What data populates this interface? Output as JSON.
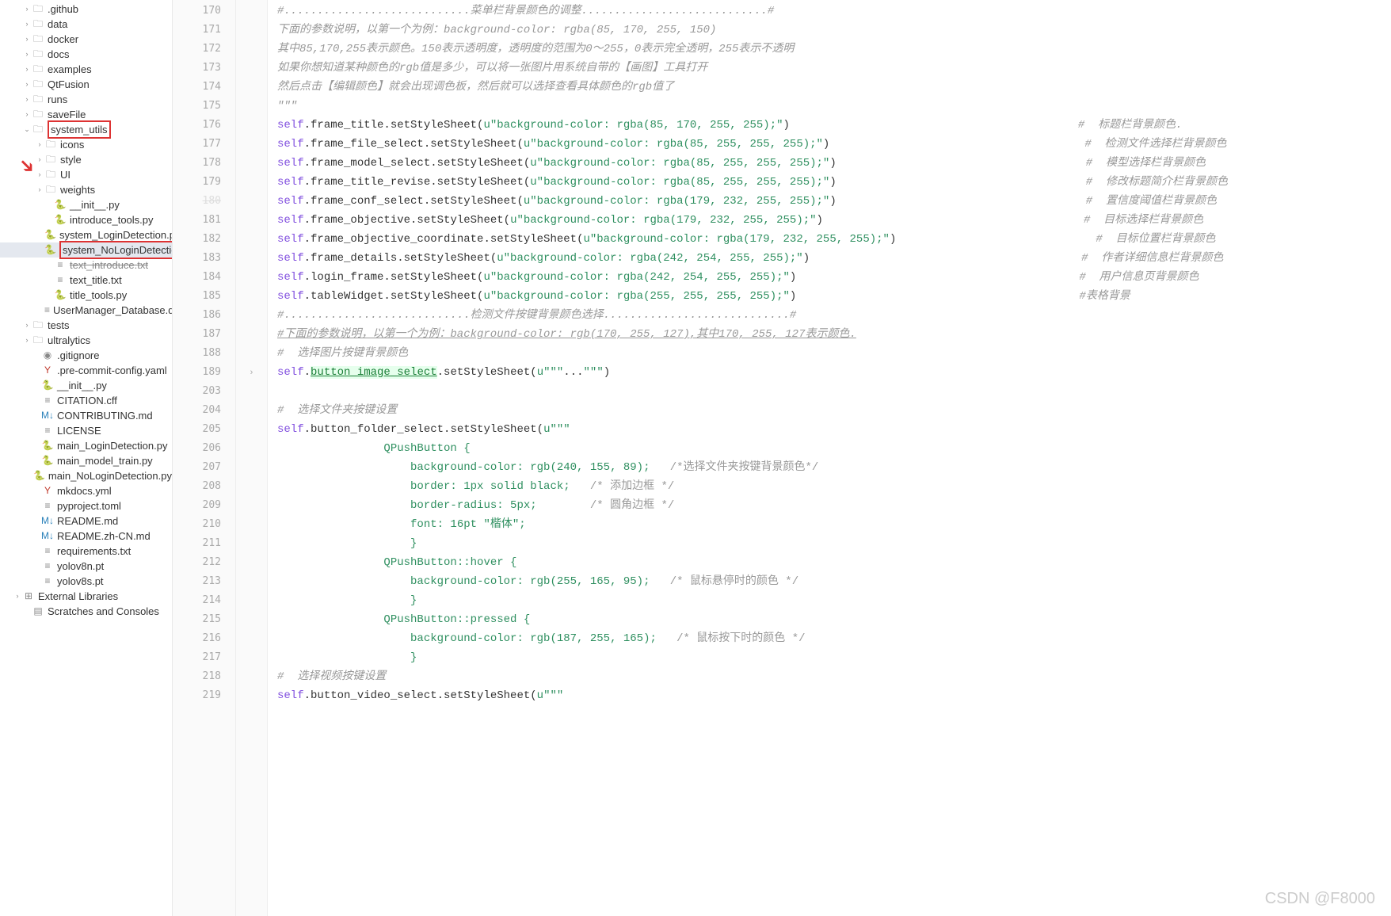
{
  "tree": [
    {
      "indent": 28,
      "arrow": "›",
      "icon": "folder",
      "label": ".github"
    },
    {
      "indent": 28,
      "arrow": "›",
      "icon": "folder",
      "label": "data"
    },
    {
      "indent": 28,
      "arrow": "›",
      "icon": "folder",
      "label": "docker"
    },
    {
      "indent": 28,
      "arrow": "›",
      "icon": "folder",
      "label": "docs"
    },
    {
      "indent": 28,
      "arrow": "›",
      "icon": "folder",
      "label": "examples"
    },
    {
      "indent": 28,
      "arrow": "›",
      "icon": "folder",
      "label": "QtFusion"
    },
    {
      "indent": 28,
      "arrow": "›",
      "icon": "folder",
      "label": "runs"
    },
    {
      "indent": 28,
      "arrow": "›",
      "icon": "folder",
      "label": "saveFile"
    },
    {
      "indent": 28,
      "arrow": "⌄",
      "icon": "folder",
      "label": "system_utils",
      "boxed": true
    },
    {
      "indent": 44,
      "arrow": "›",
      "icon": "folder",
      "label": "icons"
    },
    {
      "indent": 44,
      "arrow": "›",
      "icon": "folder",
      "label": "style"
    },
    {
      "indent": 44,
      "arrow": "›",
      "icon": "folder",
      "label": "UI"
    },
    {
      "indent": 44,
      "arrow": "›",
      "icon": "folder",
      "label": "weights"
    },
    {
      "indent": 56,
      "arrow": "",
      "icon": "py",
      "label": "__init__.py"
    },
    {
      "indent": 56,
      "arrow": "",
      "icon": "py",
      "label": "introduce_tools.py"
    },
    {
      "indent": 56,
      "arrow": "",
      "icon": "py",
      "label": "system_LoginDetection.py"
    },
    {
      "indent": 56,
      "arrow": "",
      "icon": "py",
      "label": "system_NoLoginDetection.py",
      "boxed": true,
      "selected": true
    },
    {
      "indent": 56,
      "arrow": "",
      "icon": "txt",
      "label": "text_introduce.txt",
      "strike": true
    },
    {
      "indent": 56,
      "arrow": "",
      "icon": "txt",
      "label": "text_title.txt"
    },
    {
      "indent": 56,
      "arrow": "",
      "icon": "py",
      "label": "title_tools.py"
    },
    {
      "indent": 56,
      "arrow": "",
      "icon": "db",
      "label": "UserManager_Database.db"
    },
    {
      "indent": 28,
      "arrow": "›",
      "icon": "folder",
      "label": "tests"
    },
    {
      "indent": 28,
      "arrow": "›",
      "icon": "folder",
      "label": "ultralytics"
    },
    {
      "indent": 40,
      "arrow": "",
      "icon": "git",
      "label": ".gitignore"
    },
    {
      "indent": 40,
      "arrow": "",
      "icon": "yaml",
      "label": ".pre-commit-config.yaml"
    },
    {
      "indent": 40,
      "arrow": "",
      "icon": "py",
      "label": "__init__.py"
    },
    {
      "indent": 40,
      "arrow": "",
      "icon": "txt",
      "label": "CITATION.cff"
    },
    {
      "indent": 40,
      "arrow": "",
      "icon": "md",
      "label": "CONTRIBUTING.md"
    },
    {
      "indent": 40,
      "arrow": "",
      "icon": "txt",
      "label": "LICENSE"
    },
    {
      "indent": 40,
      "arrow": "",
      "icon": "py",
      "label": "main_LoginDetection.py"
    },
    {
      "indent": 40,
      "arrow": "",
      "icon": "py",
      "label": "main_model_train.py"
    },
    {
      "indent": 40,
      "arrow": "",
      "icon": "py",
      "label": "main_NoLoginDetection.py"
    },
    {
      "indent": 40,
      "arrow": "",
      "icon": "yaml",
      "label": "mkdocs.yml"
    },
    {
      "indent": 40,
      "arrow": "",
      "icon": "txt",
      "label": "pyproject.toml"
    },
    {
      "indent": 40,
      "arrow": "",
      "icon": "md",
      "label": "README.md"
    },
    {
      "indent": 40,
      "arrow": "",
      "icon": "md",
      "label": "README.zh-CN.md"
    },
    {
      "indent": 40,
      "arrow": "",
      "icon": "txt",
      "label": "requirements.txt"
    },
    {
      "indent": 40,
      "arrow": "",
      "icon": "txt",
      "label": "yolov8n.pt"
    },
    {
      "indent": 40,
      "arrow": "",
      "icon": "txt",
      "label": "yolov8s.pt"
    },
    {
      "indent": 16,
      "arrow": "›",
      "icon": "lib",
      "label": "External Libraries"
    },
    {
      "indent": 28,
      "arrow": "",
      "icon": "scratch",
      "label": "Scratches and Consoles"
    }
  ],
  "lines": [
    170,
    171,
    172,
    173,
    174,
    175,
    176,
    177,
    178,
    179,
    "180",
    181,
    182,
    183,
    184,
    185,
    186,
    187,
    188,
    189,
    203,
    204,
    205,
    206,
    207,
    208,
    209,
    210,
    211,
    212,
    213,
    214,
    215,
    216,
    217,
    218,
    219
  ],
  "fold_marks": {
    "189": "›"
  },
  "code_comments": {
    "0": "#............................菜单栏背景颜色的调整............................#",
    "1": "下面的参数说明，以第一个为例：background-color: rgba(85, 170, 255, 150)",
    "2": "其中85,170,255表示颜色。150表示透明度，透明度的范围为0～255，0表示完全透明，255表示不透明",
    "3": "如果你想知道某种颜色的rgb值是多少，可以将一张图片用系统自带的【画图】工具打开",
    "4": "然后点击【编辑颜色】就会出现调色板，然后就可以选择查看具体颜色的rgb值了",
    "5": "\"\"\"",
    "16": "#............................检测文件按键背景颜色选择............................#",
    "17": "#下面的参数说明，以第一个为例：background-color: rgb(170, 255, 127),其中170, 255, 127表示颜色.",
    "18": "#  选择图片按键背景颜色",
    "21": "#  选择文件夹按键设置",
    "35": "#  选择视频按键设置"
  },
  "code_calls": [
    {
      "row": 6,
      "attr": "frame_title",
      "rgba": "85, 170, 255, 255",
      "cmt": "#  标题栏背景颜色."
    },
    {
      "row": 7,
      "attr": "frame_file_select",
      "rgba": "85, 255, 255, 255",
      "cmt": "#  检测文件选择栏背景颜色"
    },
    {
      "row": 8,
      "attr": "frame_model_select",
      "rgba": "85, 255, 255, 255",
      "cmt": "#  模型选择栏背景颜色"
    },
    {
      "row": 9,
      "attr": "frame_title_revise",
      "rgba": "85, 255, 255, 255",
      "cmt": "#  修改标题简介栏背景颜色"
    },
    {
      "row": 10,
      "attr": "frame_conf_select",
      "rgba": "179, 232, 255, 255",
      "cmt": "#  置信度阈值栏背景颜色"
    },
    {
      "row": 11,
      "attr": "frame_objective",
      "rgba": "179, 232, 255, 255",
      "cmt": "#  目标选择栏背景颜色"
    },
    {
      "row": 12,
      "attr": "frame_objective_coordinate",
      "rgba": "179, 232, 255, 255",
      "cmt": "#  目标位置栏背景颜色"
    },
    {
      "row": 13,
      "attr": "frame_details",
      "rgba": "242, 254, 255, 255",
      "cmt": "#  作者详细信息栏背景颜色"
    },
    {
      "row": 14,
      "attr": "login_frame",
      "rgba": "242, 254, 255, 255",
      "cmt": "#  用户信息页背景颜色"
    },
    {
      "row": 15,
      "attr": "tableWidget",
      "rgba": "255, 255, 255, 255",
      "cmt": "#表格背景"
    }
  ],
  "button_image": {
    "row": 19,
    "attr": "button_image_select",
    "suffix": ".setStyleSheet(u\"\"\"...\"\"\")"
  },
  "folder_block": {
    "row": 22,
    "attr": "button_folder_select",
    "lines": [
      "                QPushButton {",
      "                    background-color: rgb(240, 155, 89);   /*选择文件夹按键背景颜色*/",
      "                    border: 1px solid black;   /* 添加边框 */",
      "                    border-radius: 5px;        /* 圆角边框 */",
      "                    font: 16pt \"楷体\";",
      "                    }",
      "                QPushButton::hover {",
      "                    background-color: rgb(255, 165, 95);   /* 鼠标悬停时的颜色 */",
      "                    }",
      "                QPushButton::pressed {",
      "                    background-color: rgb(187, 255, 165);   /* 鼠标按下时的颜色 */",
      "                    }",
      "                \"\"\")"
    ]
  },
  "video_call": {
    "row": 36,
    "attr": "button_video_select"
  },
  "watermark": "CSDN @F8000"
}
